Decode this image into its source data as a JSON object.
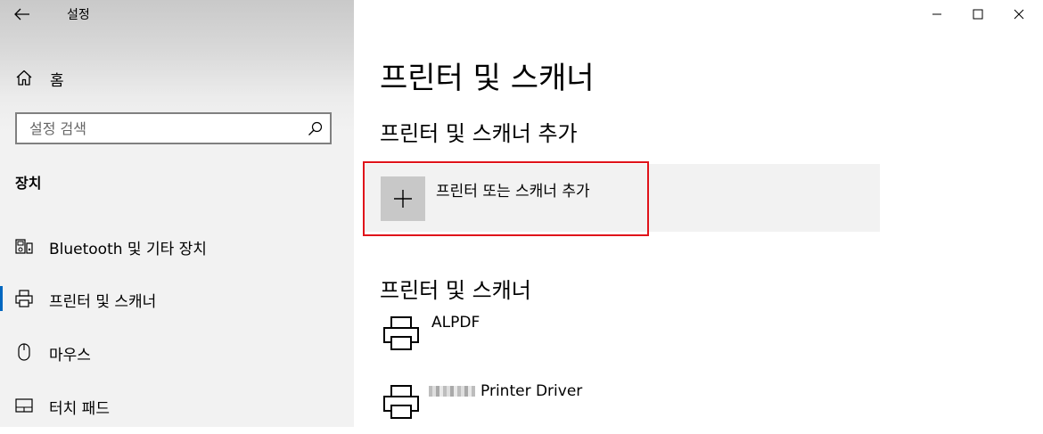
{
  "app": {
    "title": "설정"
  },
  "sidebar": {
    "home_label": "홈",
    "search_placeholder": "설정 검색",
    "section": "장치",
    "items": [
      {
        "label": "Bluetooth 및 기타 장치",
        "icon": "bluetooth-devices-icon",
        "selected": false
      },
      {
        "label": "프린터 및 스캐너",
        "icon": "printer-icon",
        "selected": true
      },
      {
        "label": "마우스",
        "icon": "mouse-icon",
        "selected": false
      },
      {
        "label": "터치 패드",
        "icon": "touchpad-icon",
        "selected": false
      }
    ]
  },
  "main": {
    "title": "프린터 및 스캐너",
    "add_section": "프린터 및 스캐너 추가",
    "add_button": "프린터 또는 스캐너 추가",
    "list_section": "프린터 및 스캐너",
    "printers": [
      {
        "name": "ALPDF",
        "name_obscured": false
      },
      {
        "name": "Printer Driver",
        "name_obscured": true
      }
    ]
  },
  "colors": {
    "highlight": "#e0131a",
    "accent": "#0067c0",
    "sidebar_bg": "#f2f2f2",
    "tile_bg": "#f2f2f2"
  }
}
